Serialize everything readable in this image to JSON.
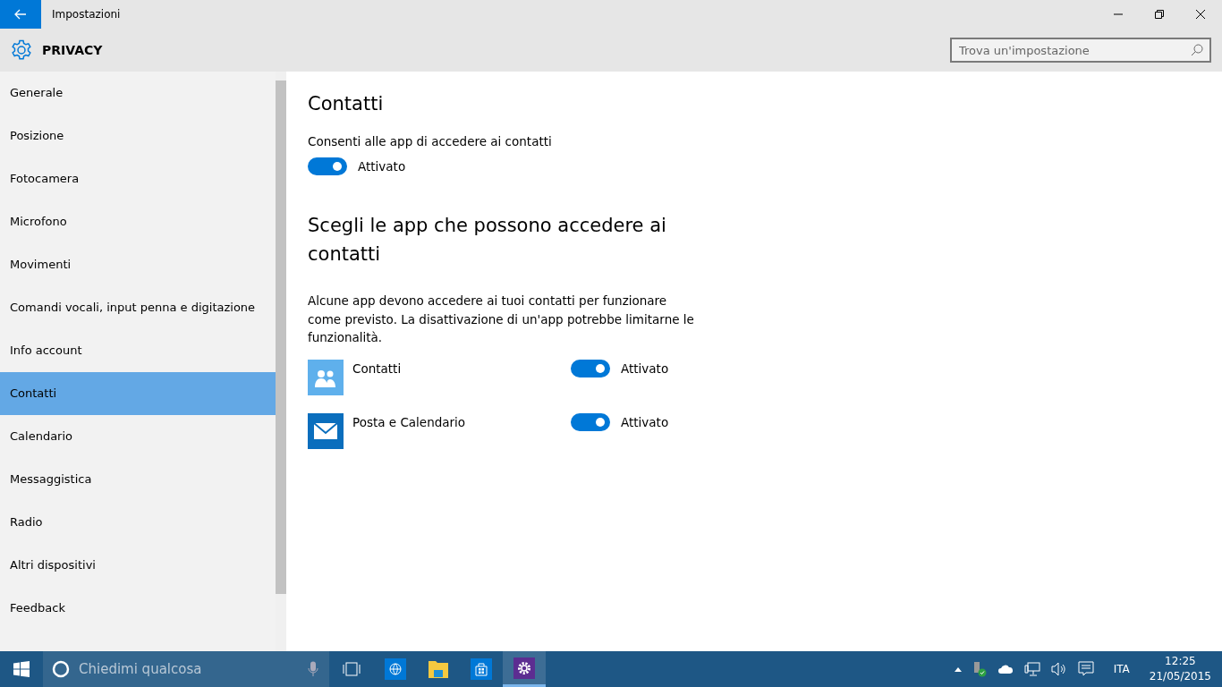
{
  "window": {
    "title": "Impostazioni"
  },
  "header": {
    "title": "PRIVACY",
    "search": {
      "placeholder": "Trova un'impostazione"
    }
  },
  "sidebar": {
    "items": [
      {
        "label": "Generale",
        "selected": false
      },
      {
        "label": "Posizione",
        "selected": false
      },
      {
        "label": "Fotocamera",
        "selected": false
      },
      {
        "label": "Microfono",
        "selected": false
      },
      {
        "label": "Movimenti",
        "selected": false
      },
      {
        "label": "Comandi vocali, input penna e digitazione",
        "selected": false
      },
      {
        "label": "Info account",
        "selected": false
      },
      {
        "label": "Contatti",
        "selected": true
      },
      {
        "label": "Calendario",
        "selected": false
      },
      {
        "label": "Messaggistica",
        "selected": false
      },
      {
        "label": "Radio",
        "selected": false
      },
      {
        "label": "Altri dispositivi",
        "selected": false
      },
      {
        "label": "Feedback",
        "selected": false
      }
    ]
  },
  "content": {
    "title": "Contatti",
    "setting_label": "Consenti alle app di accedere ai contatti",
    "main_toggle": {
      "on": true,
      "label": "Attivato"
    },
    "section_title": "Scegli le app che possono accedere ai contatti",
    "description": "Alcune app devono accedere ai tuoi contatti per funzionare come previsto. La disattivazione di un'app potrebbe limitarne le funzionalità.",
    "apps": [
      {
        "kind": "people",
        "color": "#5fb0ec",
        "name": "Contatti",
        "on": true,
        "label": "Attivato"
      },
      {
        "kind": "mail",
        "color": "#0a6ebd",
        "name": "Posta e Calendario",
        "on": true,
        "label": "Attivato"
      }
    ]
  },
  "taskbar": {
    "search": {
      "placeholder": "Chiedimi qualcosa"
    },
    "apps": [
      {
        "kind": "globe",
        "selected": false
      },
      {
        "kind": "folder",
        "selected": false
      },
      {
        "kind": "store",
        "selected": false
      },
      {
        "kind": "settings",
        "selected": true
      }
    ],
    "language": "ITA",
    "time": "12:25",
    "date": "21/05/2015"
  }
}
